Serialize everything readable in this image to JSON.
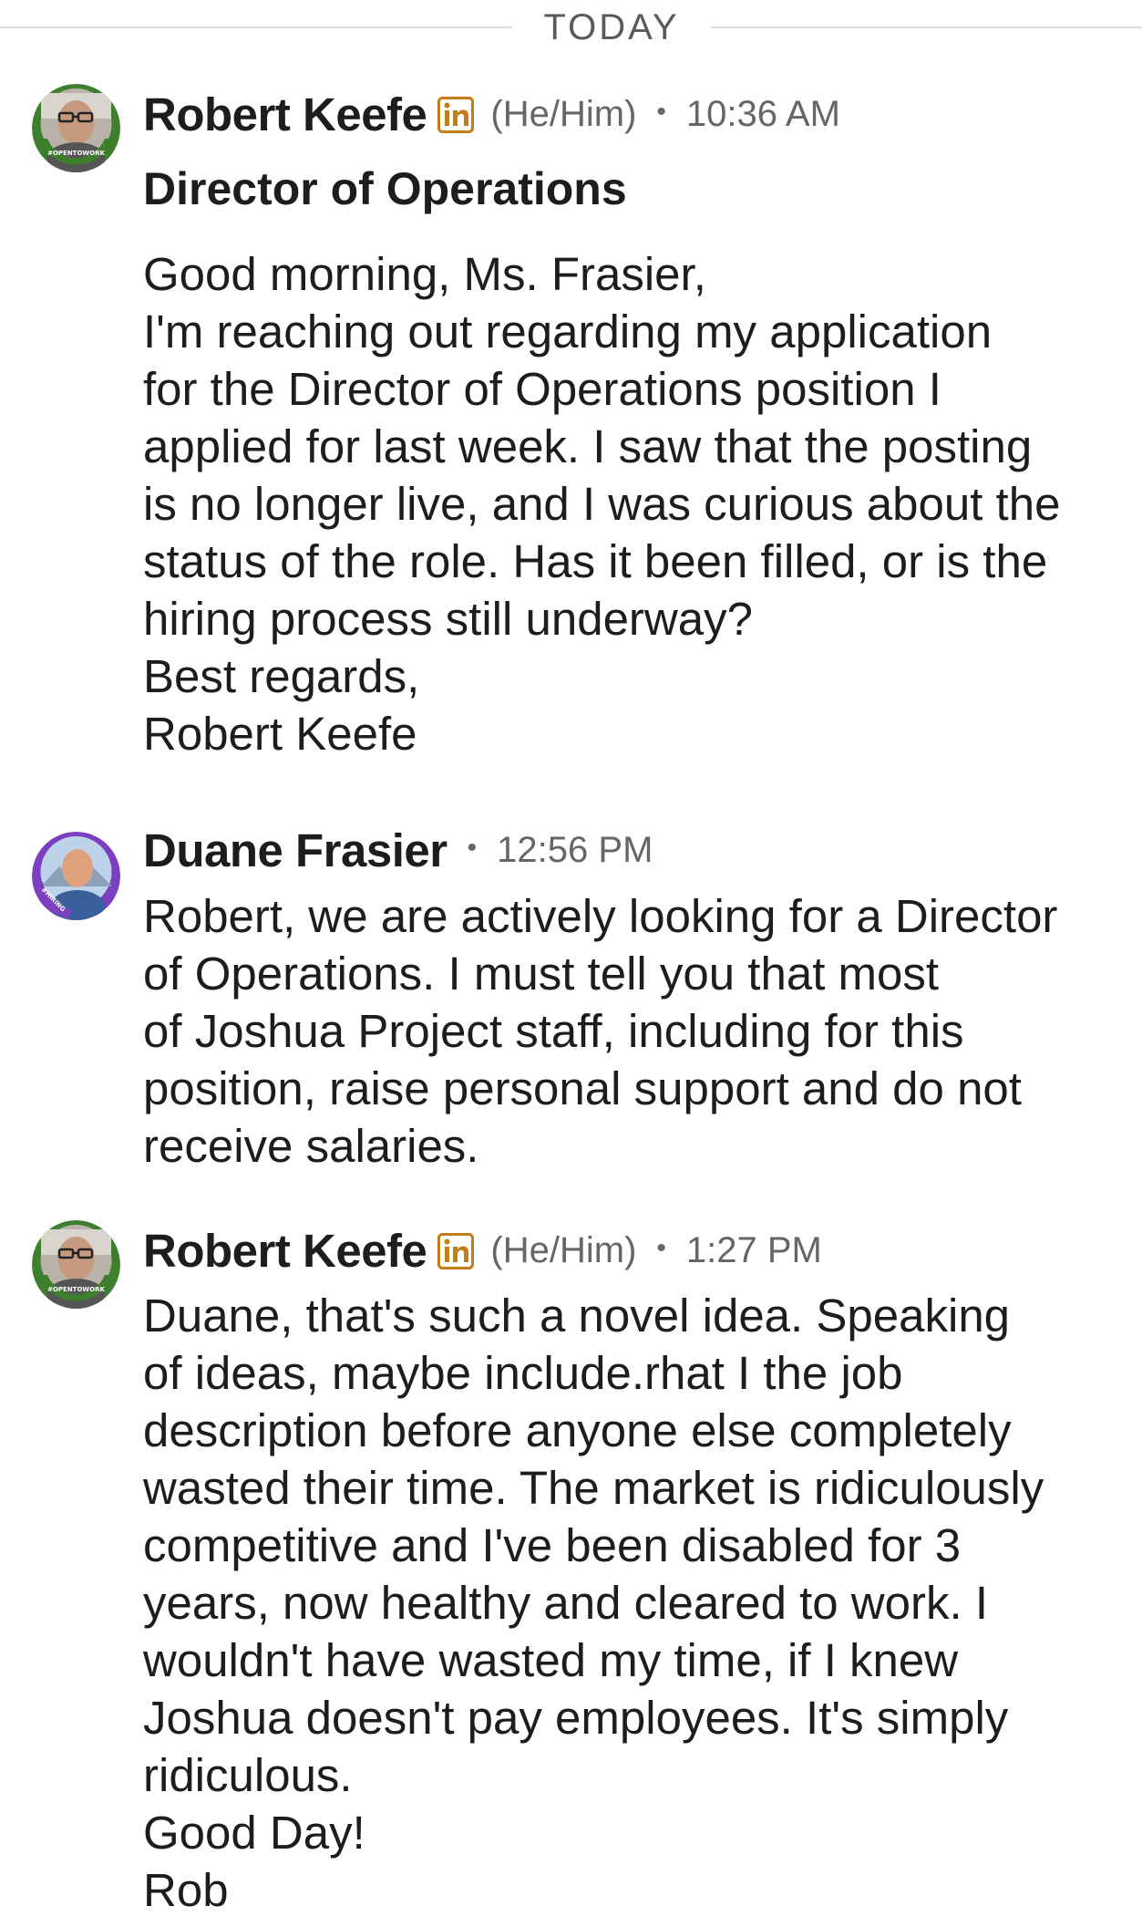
{
  "date_divider": "TODAY",
  "messages": [
    {
      "sender": "Robert Keefe",
      "pronouns": "(He/Him)",
      "time": "10:36 AM",
      "headline": "Director of Operations",
      "avatar_badge": "#OPENTOWORK",
      "body_lines": [
        "Good morning, Ms. Frasier,",
        "I'm reaching out regarding my application",
        "for the Director of Operations position I",
        "applied for last week. I saw that the posting",
        "is no longer live, and I was curious about the",
        "status of the role. Has it been filled, or is the",
        "hiring process still underway?",
        "Best regards,",
        "Robert Keefe"
      ]
    },
    {
      "sender": "Duane Frasier",
      "time": "12:56 PM",
      "avatar_badge": "#HIRING",
      "body_lines": [
        "Robert, we are actively looking for a Director",
        "of Operations. I must tell you that most",
        "of Joshua Project staff, including for this",
        "position, raise personal support and do not",
        "receive salaries."
      ]
    },
    {
      "sender": "Robert Keefe",
      "pronouns": "(He/Him)",
      "time": "1:27 PM",
      "avatar_badge": "#OPENTOWORK",
      "body_lines": [
        "Duane, that's such a novel idea. Speaking",
        "of ideas, maybe include.rhat I the job",
        "description before anyone else completely",
        "wasted their time. The market is ridiculously",
        "competitive and I've been disabled for 3",
        "years, now healthy and cleared to work. I",
        "wouldn't have wasted my time, if I knew",
        "Joshua doesn't pay employees. It's simply",
        "ridiculous.",
        "Good Day!",
        "Rob"
      ]
    }
  ],
  "separator": "•",
  "colors": {
    "linkedin_badge": "#C37D16",
    "open_to_work_ring": "#3d7f2c",
    "hiring_ring": "#7b3fbf",
    "meta_text": "#666666"
  }
}
